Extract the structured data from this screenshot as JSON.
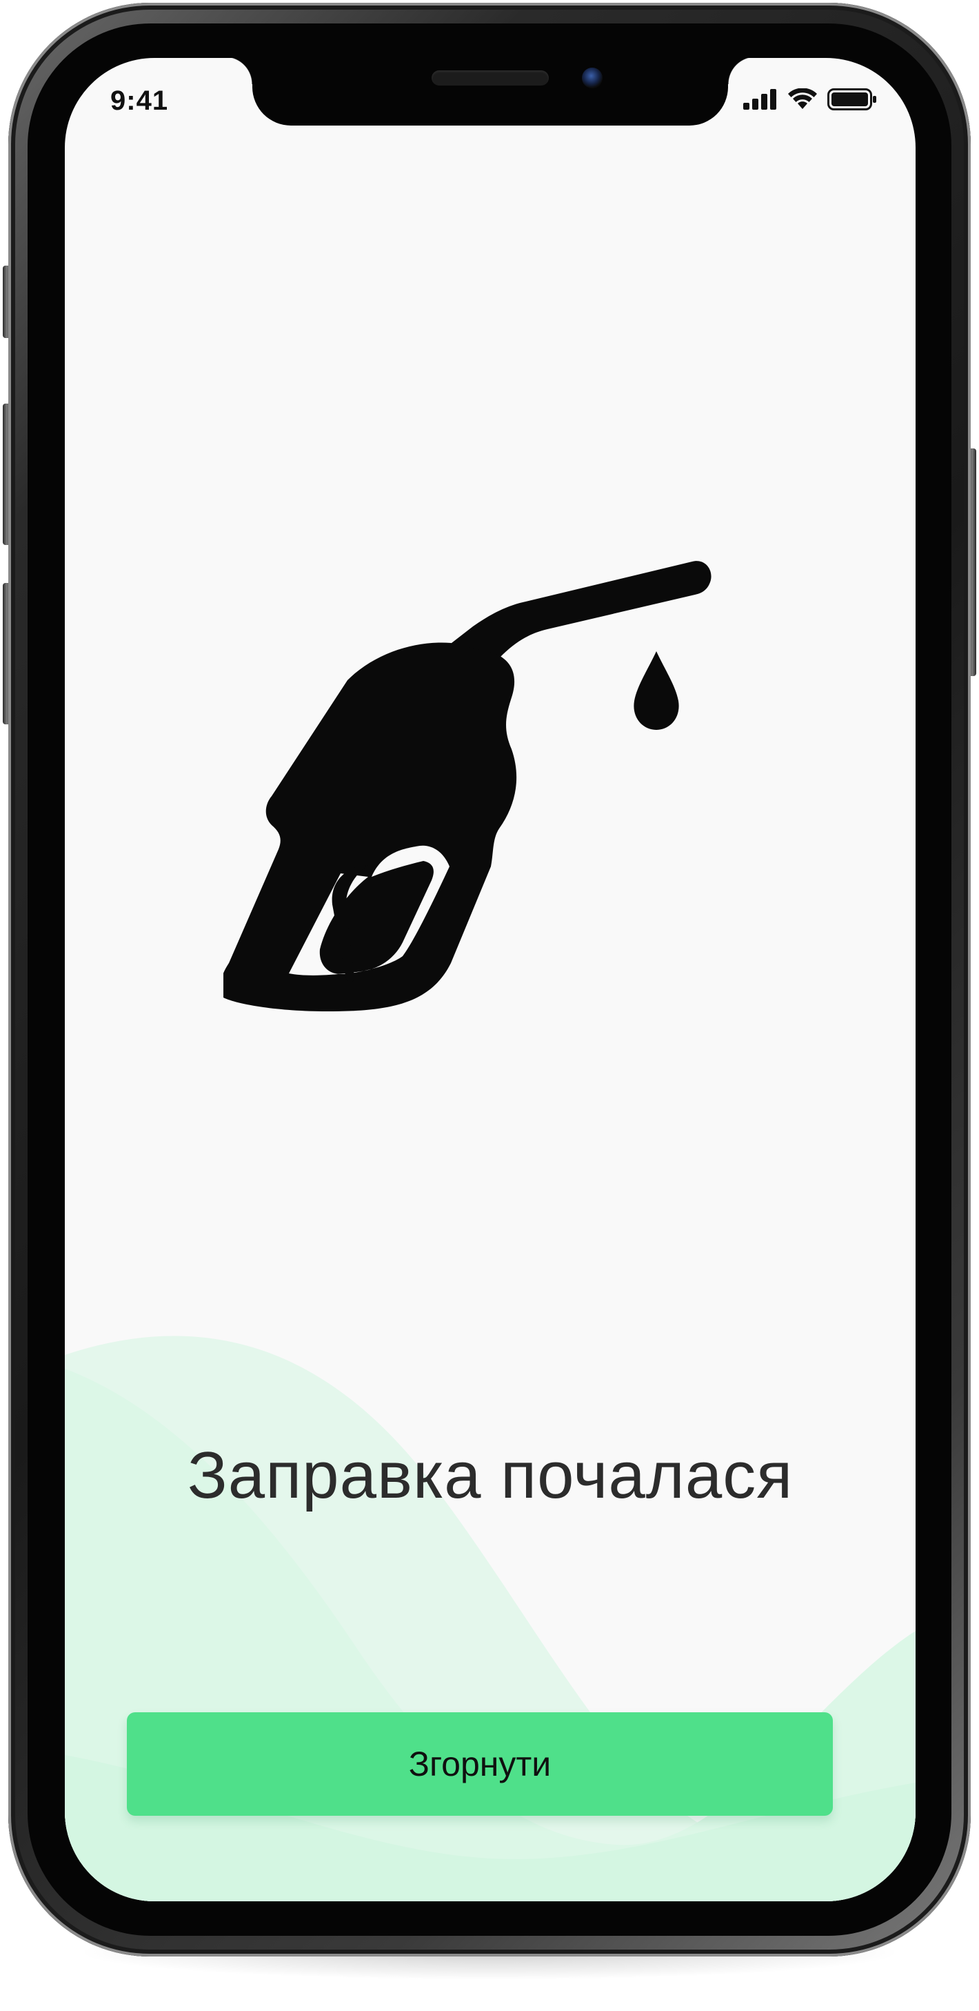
{
  "status_bar": {
    "time": "9:41",
    "icons": [
      "cellular-signal-icon",
      "wifi-icon",
      "battery-icon"
    ]
  },
  "main": {
    "illustration": "fuel-pump-nozzle-icon",
    "title": "Заправка почалася",
    "collapse_button_label": "Згорнути"
  },
  "colors": {
    "screen_background": "#f9f9f9",
    "accent_green": "#4fe08a",
    "wave_light_green": "#d6f6e3",
    "title_text": "#2c2c2c",
    "icon": "#0a0a0a"
  }
}
